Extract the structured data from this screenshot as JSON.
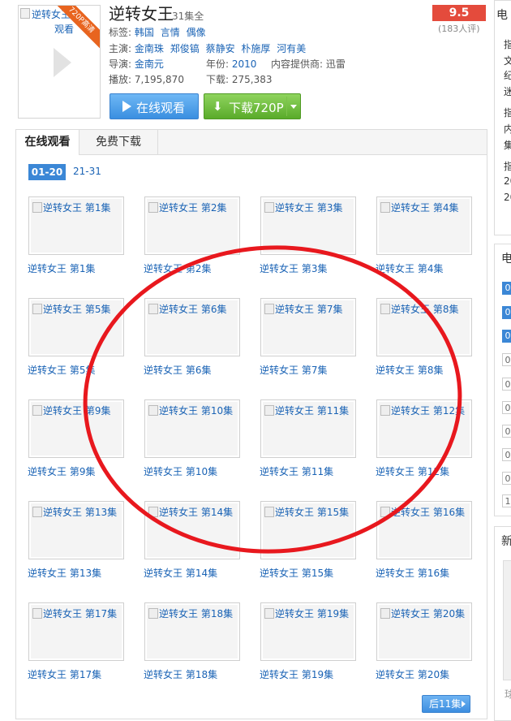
{
  "poster": {
    "alt_text": "逆转女王",
    "alt_text_2": "观看",
    "badge": "720P高清"
  },
  "show": {
    "title": "逆转女王",
    "episodes_total": "31集全"
  },
  "info": {
    "tags_label": "标签:",
    "tags": [
      "韩国",
      "言情",
      "偶像"
    ],
    "cast_label": "主演:",
    "cast": [
      "金南珠",
      "郑俊镐",
      "蔡静安",
      "朴施厚",
      "河有美"
    ],
    "director_label": "导演:",
    "director": "金南元",
    "year_label": "年份:",
    "year": "2010",
    "provider_label": "内容提供商:",
    "provider": "迅雷",
    "plays_label": "播放:",
    "plays": "7,195,870",
    "downloads_label": "下载:",
    "downloads": "275,383"
  },
  "buttons": {
    "watch_online": "在线观看",
    "download": "下载720P"
  },
  "rating": {
    "score": "9.5",
    "count": "(183人评)"
  },
  "tabs": {
    "online": "在线观看",
    "download": "免费下载"
  },
  "ranges": {
    "active": "01-20",
    "inactive": "21-31"
  },
  "episodes": [
    {
      "thumb_alt": "逆转女王  第1集",
      "label": "逆转女王  第1集"
    },
    {
      "thumb_alt": "逆转女王  第2集",
      "label": "逆转女王  第2集"
    },
    {
      "thumb_alt": "逆转女王  第3集",
      "label": "逆转女王  第3集"
    },
    {
      "thumb_alt": "逆转女王  第4集",
      "label": "逆转女王  第4集"
    },
    {
      "thumb_alt": "逆转女王  第5集",
      "label": "逆转女王  第5集"
    },
    {
      "thumb_alt": "逆转女王  第6集",
      "label": "逆转女王  第6集"
    },
    {
      "thumb_alt": "逆转女王  第7集",
      "label": "逆转女王  第7集"
    },
    {
      "thumb_alt": "逆转女王  第8集",
      "label": "逆转女王  第8集"
    },
    {
      "thumb_alt": "逆转女王  第9集",
      "label": "逆转女王  第9集"
    },
    {
      "thumb_alt": "逆转女王  第10集",
      "label": "逆转女王  第10集"
    },
    {
      "thumb_alt": "逆转女王  第11集",
      "label": "逆转女王  第11集"
    },
    {
      "thumb_alt": "逆转女王  第12集",
      "label": "逆转女王  第12集"
    },
    {
      "thumb_alt": "逆转女王  第13集",
      "label": "逆转女王  第13集"
    },
    {
      "thumb_alt": "逆转女王  第14集",
      "label": "逆转女王  第14集"
    },
    {
      "thumb_alt": "逆转女王  第15集",
      "label": "逆转女王  第15集"
    },
    {
      "thumb_alt": "逆转女王  第16集",
      "label": "逆转女王  第16集"
    },
    {
      "thumb_alt": "逆转女王  第17集",
      "label": "逆转女王  第17集"
    },
    {
      "thumb_alt": "逆转女王  第18集",
      "label": "逆转女王  第18集"
    },
    {
      "thumb_alt": "逆转女王  第19集",
      "label": "逆转女王  第19集"
    },
    {
      "thumb_alt": "逆转女王  第20集",
      "label": "逆转女王  第20集"
    }
  ],
  "pagination": {
    "next": "后11集"
  },
  "sidebar": {
    "box1_heading": "电",
    "box1_lines": [
      "指",
      "文",
      "纪",
      "迷",
      "指",
      "内",
      "集",
      "指",
      "20",
      "20"
    ],
    "box2_heading": "电",
    "box2_nums": [
      "0",
      "0",
      "0",
      "0",
      "0",
      "0",
      "0",
      "0",
      "0",
      "1"
    ],
    "box3_heading": "新",
    "box3_foot": "球"
  },
  "colors": {
    "link": "#1a63b5",
    "score_bg": "#e44b3c",
    "watch_btn": "#3a8fe0",
    "download_btn": "#5aab2a",
    "annotation": "#e8181e"
  }
}
